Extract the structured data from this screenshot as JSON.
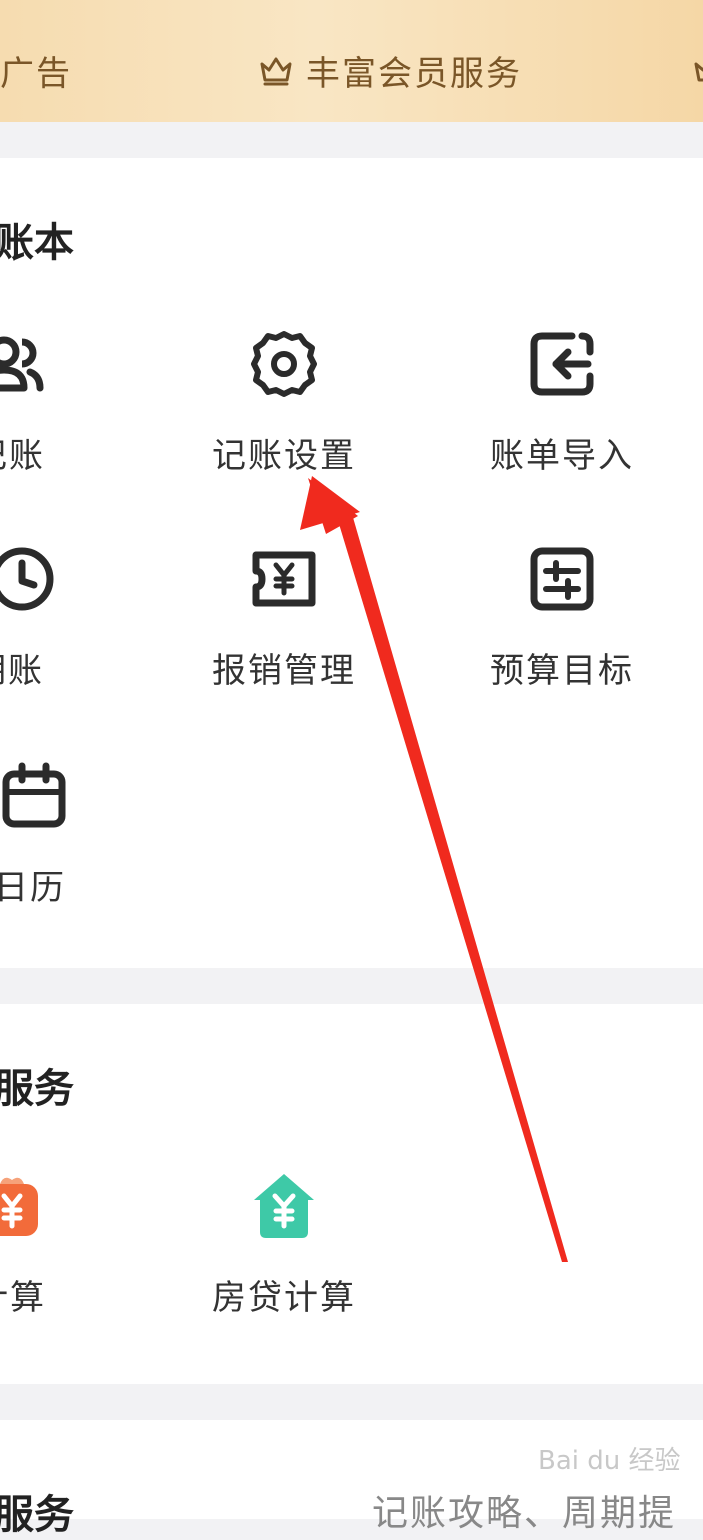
{
  "banner": {
    "item_ad": "广告",
    "item_member": "丰富会员服务"
  },
  "ledger_section": {
    "title": "账本",
    "items": [
      {
        "label": "记账",
        "icon": "people-icon"
      },
      {
        "label": "记账设置",
        "icon": "gear-icon"
      },
      {
        "label": "账单导入",
        "icon": "import-icon"
      },
      {
        "label": "期账",
        "icon": "clock-icon"
      },
      {
        "label": "报销管理",
        "icon": "reimburse-icon"
      },
      {
        "label": "预算目标",
        "icon": "budget-icon"
      },
      {
        "label": "日历",
        "icon": "calendar-icon"
      }
    ]
  },
  "service_section": {
    "title": "服务",
    "items": [
      {
        "label": "计算",
        "icon": "salary-icon"
      },
      {
        "label": "房贷计算",
        "icon": "house-loan-icon"
      }
    ]
  },
  "bottom_section": {
    "title": "服务",
    "subtitle": "记账攻略、周期提"
  },
  "watermark": "Bai du 经验",
  "colors": {
    "arrow": "#f02a1e",
    "icon_stroke": "#2b2b2b",
    "house_green": "#3ec9a7",
    "salary_orange": "#f26b3a"
  }
}
